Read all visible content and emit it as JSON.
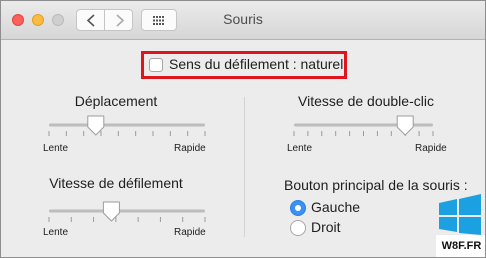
{
  "window": {
    "title": "Souris"
  },
  "natural_scroll": {
    "label": "Sens du défilement : naturel",
    "checked": false
  },
  "tracking": {
    "label": "Déplacement",
    "min_label": "Lente",
    "max_label": "Rapide",
    "value": 0.3,
    "ticks": 10
  },
  "double_click": {
    "label": "Vitesse de double-clic",
    "min_label": "Lente",
    "max_label": "Rapide",
    "value": 0.8,
    "ticks": 11
  },
  "scrolling": {
    "label": "Vitesse de défilement",
    "min_label": "Lente",
    "max_label": "Rapide",
    "value": 0.4,
    "ticks": 8
  },
  "primary_button": {
    "label": "Bouton principal de la souris :",
    "options": [
      {
        "label": "Gauche",
        "selected": true
      },
      {
        "label": "Droit",
        "selected": false
      }
    ]
  },
  "watermark": {
    "text": "W8F.FR"
  },
  "colors": {
    "highlight": "#e0141e",
    "accent": "#3b92f5",
    "background": "#ececec"
  }
}
